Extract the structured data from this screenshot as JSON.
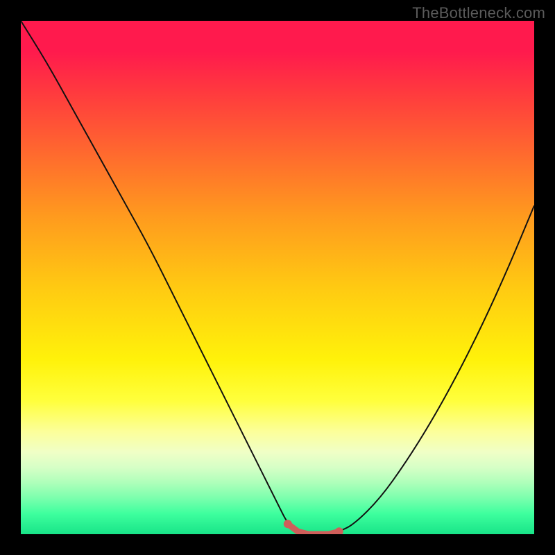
{
  "watermark": "TheBottleneck.com",
  "colors": {
    "gradient_top": "#ff1a4d",
    "gradient_bottom": "#18e488",
    "curve": "#111111",
    "flat_band": "#cf5e5a",
    "background": "#000000"
  },
  "chart_data": {
    "type": "line",
    "title": "",
    "xlabel": "",
    "ylabel": "",
    "xlim": [
      0,
      100
    ],
    "ylim": [
      0,
      100
    ],
    "x": [
      0,
      5,
      10,
      15,
      20,
      25,
      30,
      35,
      40,
      45,
      50,
      52,
      54,
      56,
      58,
      60,
      62,
      65,
      70,
      75,
      80,
      85,
      90,
      95,
      100
    ],
    "values": [
      100,
      92,
      83,
      74,
      65,
      56,
      46,
      36,
      26,
      16,
      6,
      2,
      0.5,
      0,
      0,
      0,
      0.5,
      2,
      7,
      14,
      22,
      31,
      41,
      52,
      64
    ],
    "flat_region_x": [
      52,
      63
    ],
    "annotations": []
  }
}
